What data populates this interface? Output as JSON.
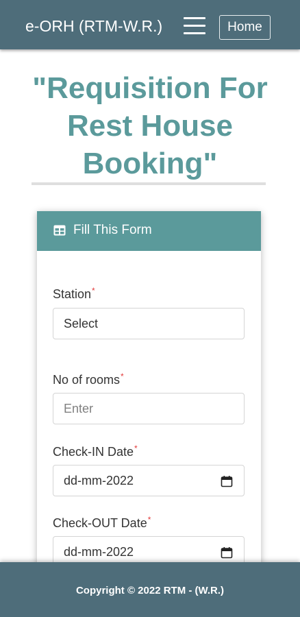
{
  "navbar": {
    "brand": "e-ORH (RTM-W.R.)",
    "menu_icon": "hamburger-menu-icon",
    "home_label": "Home"
  },
  "page": {
    "title_line1": "\"Requisition For",
    "title_line2": "Rest House",
    "title_line3": "Booking\""
  },
  "form": {
    "header_icon": "table-icon",
    "header_title": "Fill This Form",
    "required_mark": "*",
    "station": {
      "label": "Station",
      "value": "Select"
    },
    "rooms": {
      "label": "No of rooms",
      "placeholder": "Enter"
    },
    "checkin": {
      "label": "Check-IN Date",
      "value": "dd-mm-2022",
      "icon": "calendar-icon"
    },
    "checkout": {
      "label": "Check-OUT Date",
      "value": "dd-mm-2022",
      "icon": "calendar-icon"
    }
  },
  "footer": {
    "copyright": "Copyright © 2022 RTM - (W.R.)"
  },
  "colors": {
    "navbar_bg": "#4e6d7a",
    "accent_teal": "#5b9a9b",
    "required_red": "#e23a3a"
  }
}
